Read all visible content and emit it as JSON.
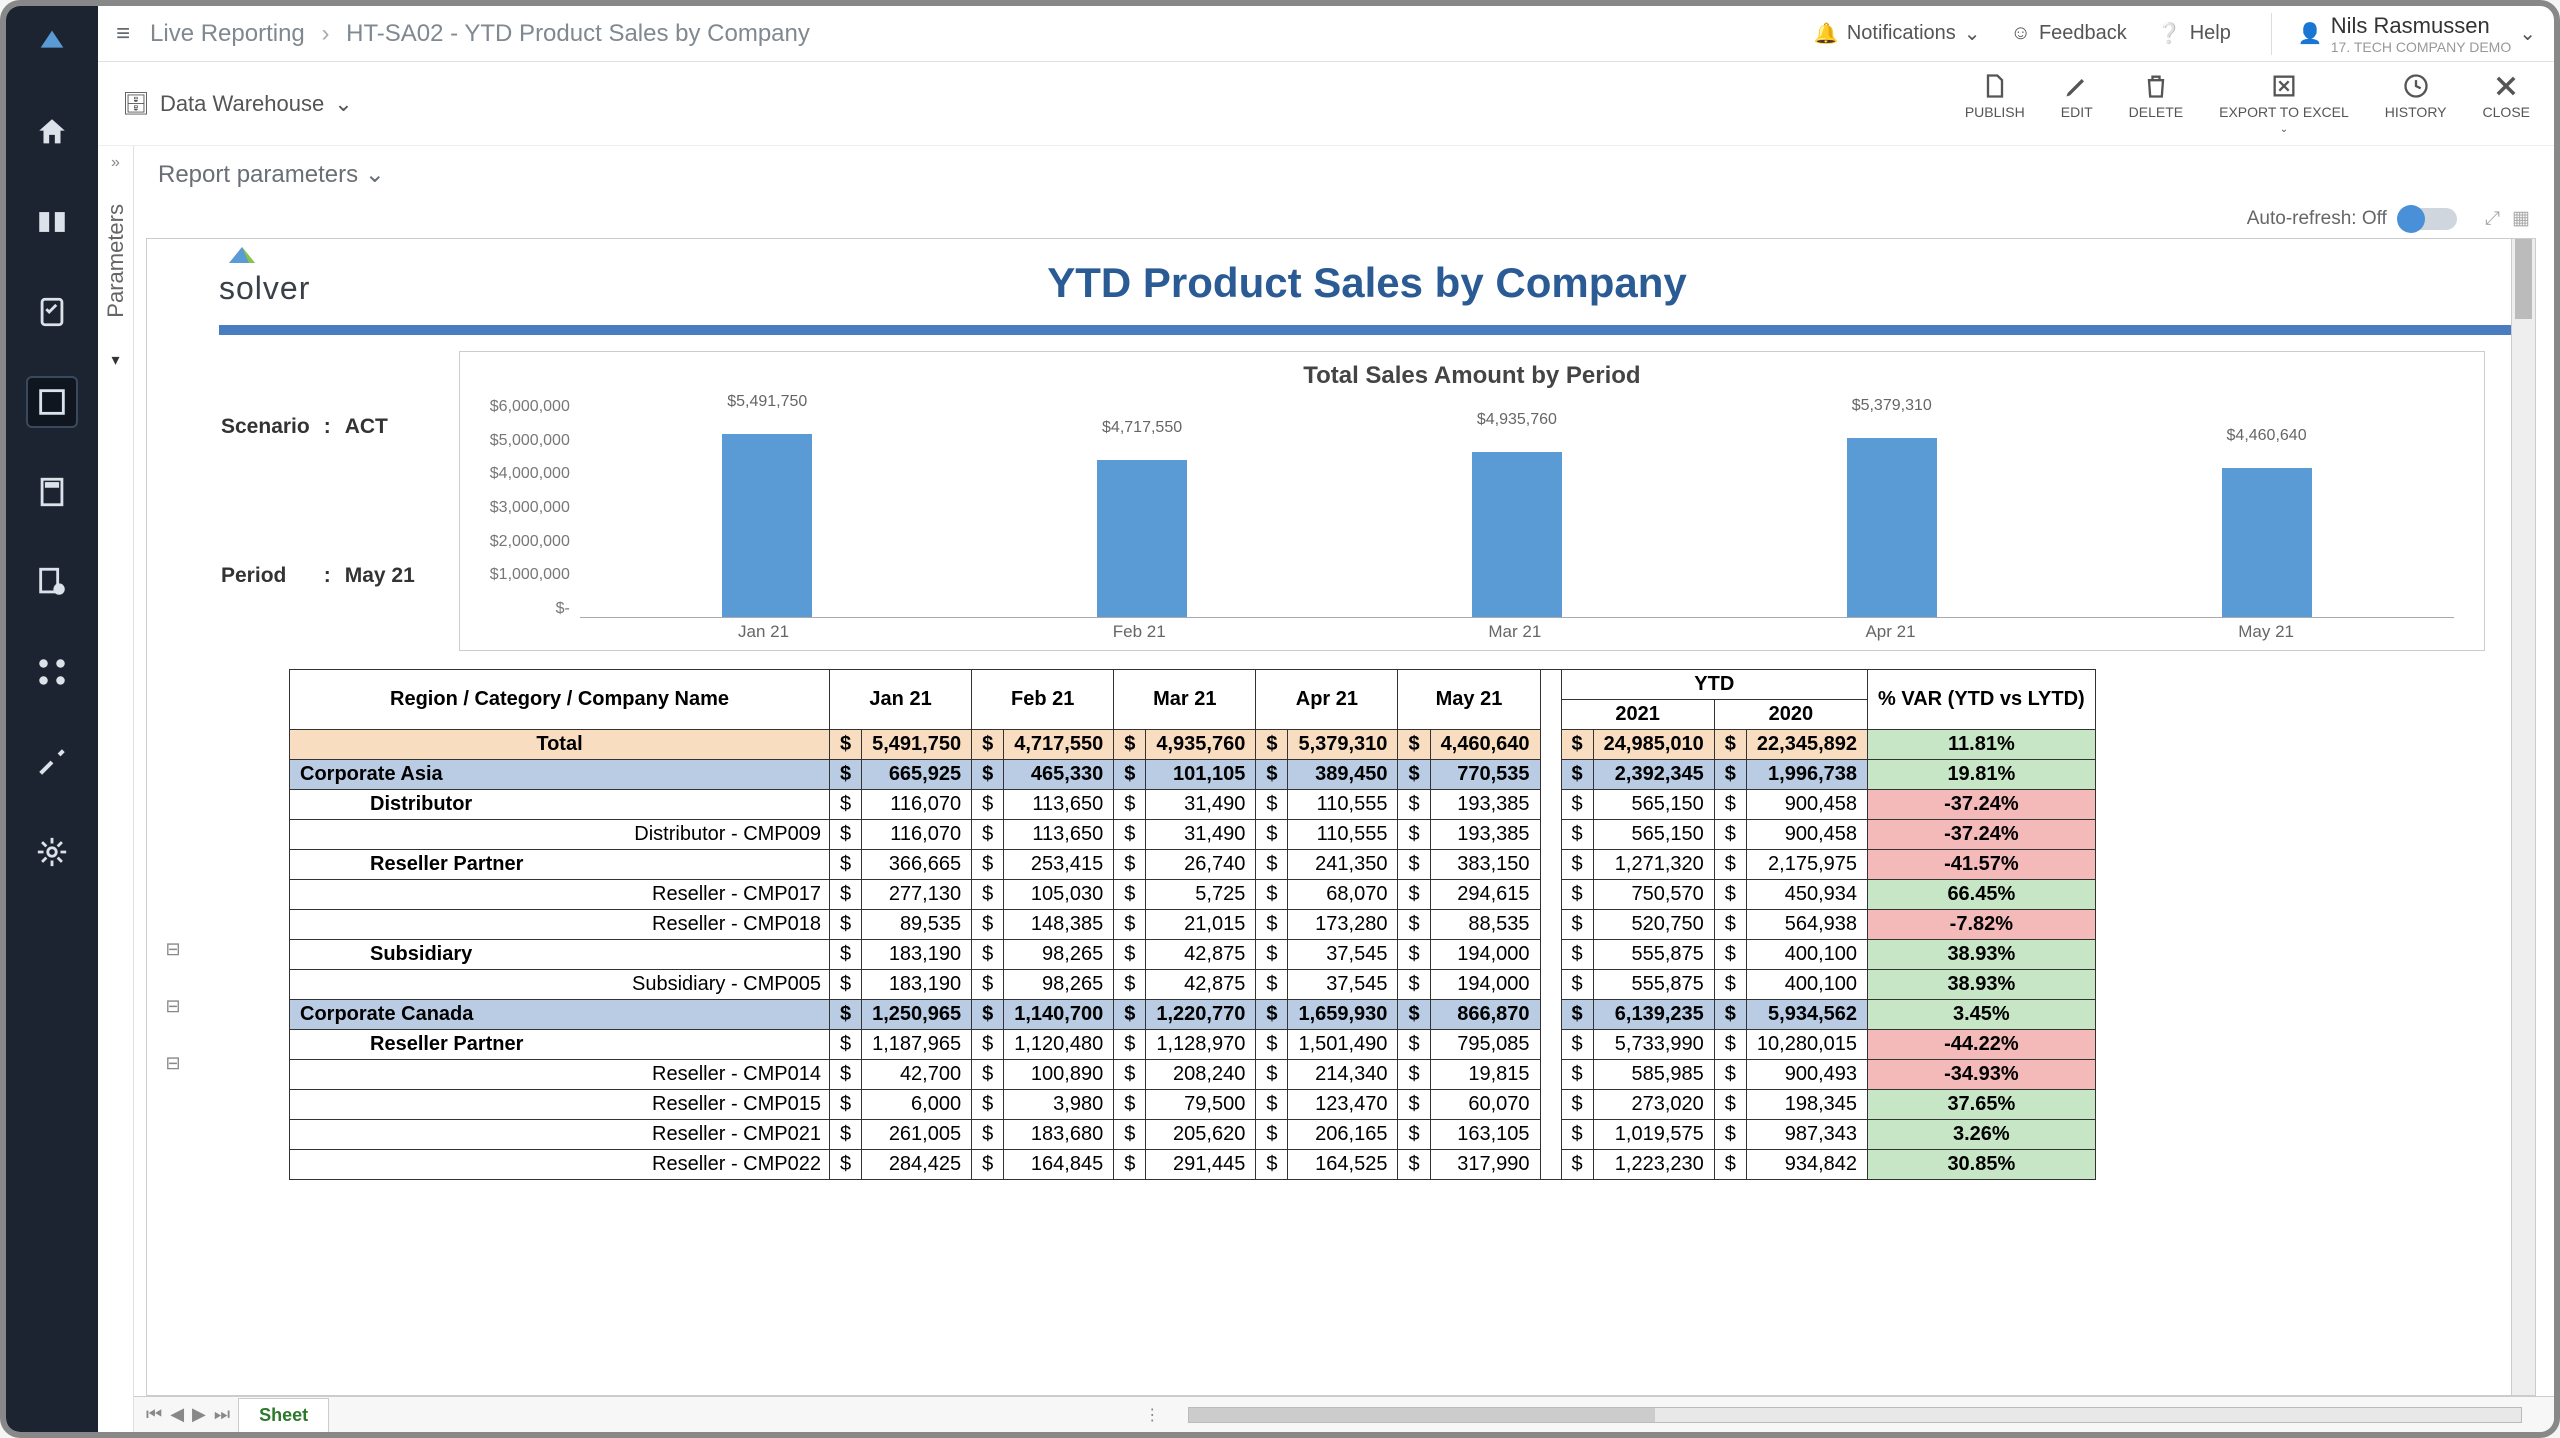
{
  "breadcrumb": {
    "root": "Live Reporting",
    "page": "HT-SA02 - YTD Product Sales by Company"
  },
  "topLinks": {
    "notifications": "Notifications",
    "feedback": "Feedback",
    "help": "Help"
  },
  "user": {
    "name": "Nils Rasmussen",
    "company": "17. Tech Company Demo"
  },
  "dataSource": "Data Warehouse",
  "toolbar": {
    "publish": "PUBLISH",
    "edit": "EDIT",
    "delete": "DELETE",
    "export": "EXPORT TO EXCEL",
    "history": "HISTORY",
    "close": "CLOSE"
  },
  "paramPanel": "Parameters",
  "reportParams": "Report parameters",
  "autoRefresh": "Auto-refresh: Off",
  "logo": "solver",
  "reportTitle": "YTD Product Sales by Company",
  "scenario": {
    "label1": "Scenario",
    "val1": "ACT",
    "label2": "Period",
    "val2": "May 21"
  },
  "chart_data": {
    "type": "bar",
    "title": "Total Sales Amount by Period",
    "categories": [
      "Jan 21",
      "Feb 21",
      "Mar 21",
      "Apr 21",
      "May 21"
    ],
    "values": [
      5491750,
      4717550,
      4935760,
      5379310,
      4460640
    ],
    "value_labels": [
      "$5,491,750",
      "$4,717,550",
      "$4,935,760",
      "$5,379,310",
      "$4,460,640"
    ],
    "y_ticks": [
      "$6,000,000",
      "$5,000,000",
      "$4,000,000",
      "$3,000,000",
      "$2,000,000",
      "$1,000,000",
      "$-"
    ],
    "ylim": [
      0,
      6000000
    ]
  },
  "tableHeaders": {
    "rowHeader": "Region / Category / Company Name",
    "months": [
      "Jan 21",
      "Feb 21",
      "Mar 21",
      "Apr 21",
      "May 21"
    ],
    "ytd": "YTD",
    "y2021": "2021",
    "y2020": "2020",
    "var": "% VAR (YTD vs LYTD)",
    "total": "Total"
  },
  "rows": [
    {
      "type": "total",
      "label": "Total",
      "m": [
        "5,491,750",
        "4,717,550",
        "4,935,760",
        "5,379,310",
        "4,460,640"
      ],
      "y21": "24,985,010",
      "y20": "22,345,892",
      "var": "11.81%",
      "pos": true
    },
    {
      "type": "region",
      "label": "Corporate Asia",
      "m": [
        "665,925",
        "465,330",
        "101,105",
        "389,450",
        "770,535"
      ],
      "y21": "2,392,345",
      "y20": "1,996,738",
      "var": "19.81%",
      "pos": true
    },
    {
      "type": "cat",
      "label": "Distributor",
      "m": [
        "116,070",
        "113,650",
        "31,490",
        "110,555",
        "193,385"
      ],
      "y21": "565,150",
      "y20": "900,458",
      "var": "-37.24%",
      "pos": false
    },
    {
      "type": "comp",
      "label": "Distributor - CMP009",
      "m": [
        "116,070",
        "113,650",
        "31,490",
        "110,555",
        "193,385"
      ],
      "y21": "565,150",
      "y20": "900,458",
      "var": "-37.24%",
      "pos": false
    },
    {
      "type": "cat",
      "label": "Reseller Partner",
      "m": [
        "366,665",
        "253,415",
        "26,740",
        "241,350",
        "383,150"
      ],
      "y21": "1,271,320",
      "y20": "2,175,975",
      "var": "-41.57%",
      "pos": false
    },
    {
      "type": "comp",
      "label": "Reseller - CMP017",
      "m": [
        "277,130",
        "105,030",
        "5,725",
        "68,070",
        "294,615"
      ],
      "y21": "750,570",
      "y20": "450,934",
      "var": "66.45%",
      "pos": true
    },
    {
      "type": "comp",
      "label": "Reseller - CMP018",
      "m": [
        "89,535",
        "148,385",
        "21,015",
        "173,280",
        "88,535"
      ],
      "y21": "520,750",
      "y20": "564,938",
      "var": "-7.82%",
      "pos": false
    },
    {
      "type": "cat",
      "label": "Subsidiary",
      "m": [
        "183,190",
        "98,265",
        "42,875",
        "37,545",
        "194,000"
      ],
      "y21": "555,875",
      "y20": "400,100",
      "var": "38.93%",
      "pos": true
    },
    {
      "type": "comp",
      "label": "Subsidiary - CMP005",
      "m": [
        "183,190",
        "98,265",
        "42,875",
        "37,545",
        "194,000"
      ],
      "y21": "555,875",
      "y20": "400,100",
      "var": "38.93%",
      "pos": true
    },
    {
      "type": "region",
      "label": "Corporate Canada",
      "m": [
        "1,250,965",
        "1,140,700",
        "1,220,770",
        "1,659,930",
        "866,870"
      ],
      "y21": "6,139,235",
      "y20": "5,934,562",
      "var": "3.45%",
      "pos": true
    },
    {
      "type": "cat",
      "label": "Reseller Partner",
      "m": [
        "1,187,965",
        "1,120,480",
        "1,128,970",
        "1,501,490",
        "795,085"
      ],
      "y21": "5,733,990",
      "y20": "10,280,015",
      "var": "-44.22%",
      "pos": false
    },
    {
      "type": "comp",
      "label": "Reseller - CMP014",
      "m": [
        "42,700",
        "100,890",
        "208,240",
        "214,340",
        "19,815"
      ],
      "y21": "585,985",
      "y20": "900,493",
      "var": "-34.93%",
      "pos": false
    },
    {
      "type": "comp",
      "label": "Reseller - CMP015",
      "m": [
        "6,000",
        "3,980",
        "79,500",
        "123,470",
        "60,070"
      ],
      "y21": "273,020",
      "y20": "198,345",
      "var": "37.65%",
      "pos": true
    },
    {
      "type": "comp",
      "label": "Reseller - CMP021",
      "m": [
        "261,005",
        "183,680",
        "205,620",
        "206,165",
        "163,105"
      ],
      "y21": "1,019,575",
      "y20": "987,343",
      "var": "3.26%",
      "pos": true
    },
    {
      "type": "comp",
      "label": "Reseller - CMP022",
      "m": [
        "284,425",
        "164,845",
        "291,445",
        "164,525",
        "317,990"
      ],
      "y21": "1,223,230",
      "y20": "934,842",
      "var": "30.85%",
      "pos": true
    }
  ],
  "sheetTab": "Sheet"
}
